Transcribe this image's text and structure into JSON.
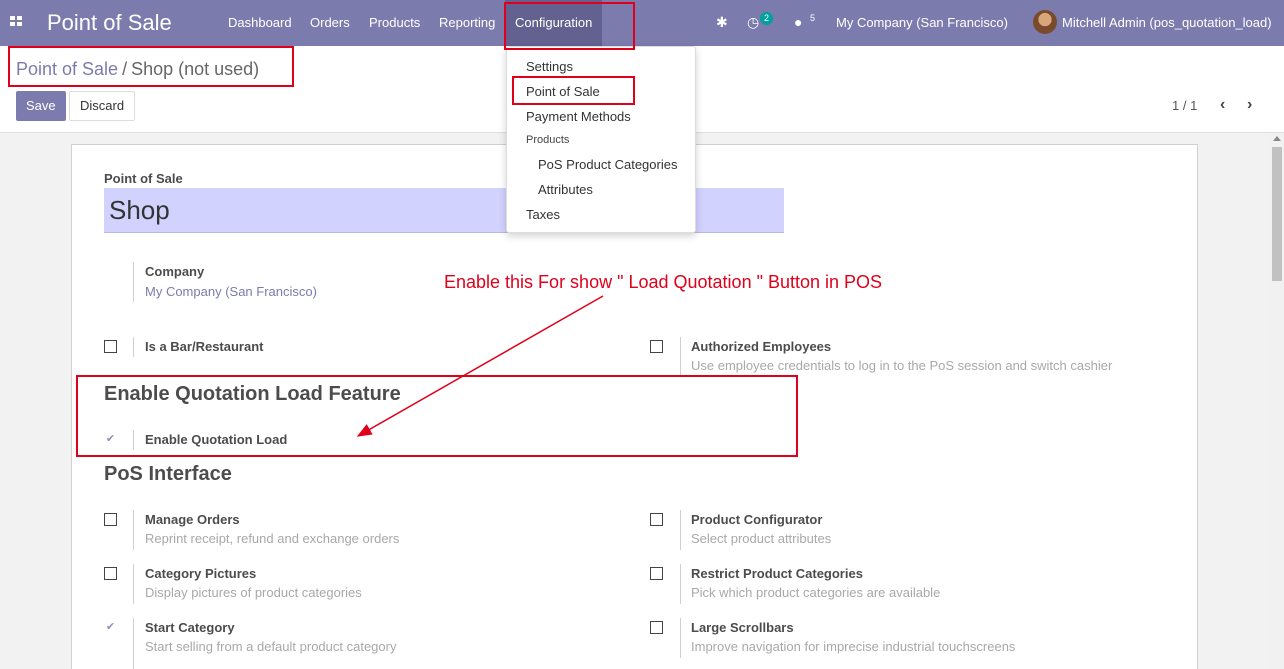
{
  "navbar": {
    "app_title": "Point of Sale",
    "menus": [
      "Dashboard",
      "Orders",
      "Products",
      "Reporting",
      "Configuration"
    ],
    "activity_badge": "2",
    "messages_badge": "5",
    "company": "My Company (San Francisco)",
    "user": "Mitchell Admin (pos_quotation_load)",
    "accent_color": "#7c7bad"
  },
  "breadcrumb": {
    "parent": "Point of Sale",
    "separator": "/",
    "current": "Shop (not used)"
  },
  "toolbar": {
    "save_label": "Save",
    "discard_label": "Discard",
    "pager": "1 / 1",
    "prev_icon": "‹",
    "next_icon": "›"
  },
  "config_menu": {
    "items": [
      "Settings",
      "Point of Sale",
      "Payment Methods"
    ],
    "products_header": "Products",
    "product_items": [
      "PoS Product Categories",
      "Attributes"
    ],
    "last_item": "Taxes"
  },
  "form": {
    "name_label": "Point of Sale",
    "name_value": "Shop",
    "company_label": "Company",
    "company_value": "My Company (San Francisco)",
    "bar_restaurant": {
      "label": "Is a Bar/Restaurant",
      "checked": false
    },
    "authorized_employees": {
      "label": "Authorized Employees",
      "help": "Use employee credentials to log in to the PoS session and switch cashier",
      "checked": false
    },
    "quotation_section": "Enable Quotation Load Feature",
    "enable_quotation": {
      "label": "Enable Quotation Load",
      "checked": true
    },
    "interface_section": "PoS Interface",
    "manage_orders": {
      "label": "Manage Orders",
      "help": "Reprint receipt, refund and exchange orders",
      "checked": false
    },
    "product_configurator": {
      "label": "Product Configurator",
      "help": "Select product attributes",
      "checked": false
    },
    "category_pictures": {
      "label": "Category Pictures",
      "help": "Display pictures of product categories",
      "checked": false
    },
    "restrict_categories": {
      "label": "Restrict Product Categories",
      "help": "Pick which product categories are available",
      "checked": false
    },
    "start_category": {
      "label": "Start Category",
      "help": "Start selling from a default product category",
      "checked": true
    },
    "large_scrollbars": {
      "label": "Large Scrollbars",
      "help": "Improve navigation for imprecise industrial touchscreens",
      "checked": false
    }
  },
  "annotation": {
    "text": "Enable this For show \" Load Quotation \" Button in POS",
    "color": "#e0001b"
  }
}
